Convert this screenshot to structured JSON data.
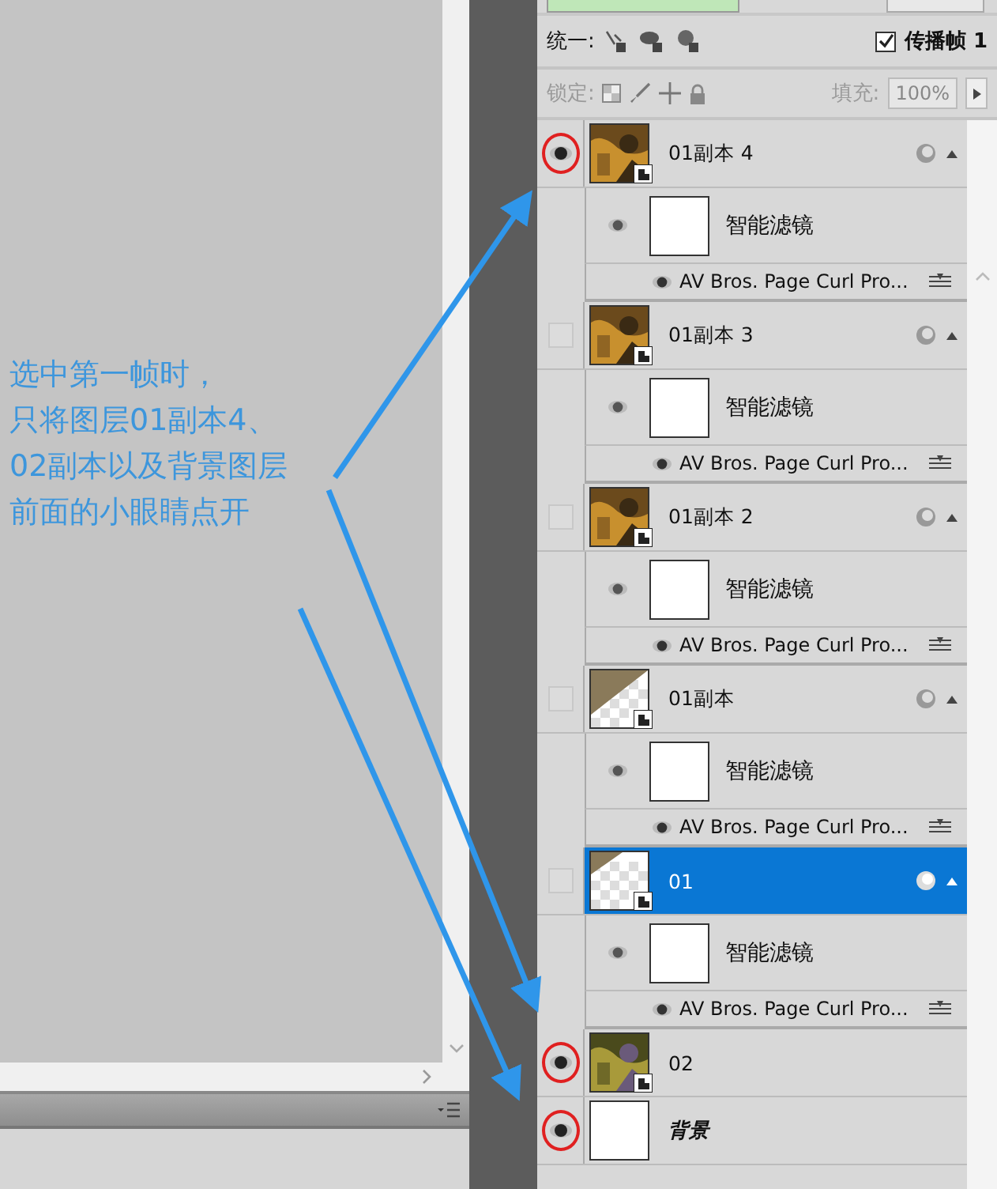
{
  "annotation": {
    "lines": [
      "选中第一帧时，",
      "只将图层01副本4、",
      "02副本以及背景图层",
      "前面的小眼睛点开"
    ]
  },
  "panel": {
    "unify_label": "统一:",
    "propagate": {
      "label": "传播帧 1",
      "checked": true
    },
    "lock_label": "锁定:",
    "fill_label": "填充:",
    "fill_value": "100%"
  },
  "layers": [
    {
      "name": "01副本 4",
      "visible": true,
      "highlighted": true,
      "selected": false,
      "filter": {
        "label": "智能滤镜",
        "effect": "AV Bros. Page Curl Pro..."
      }
    },
    {
      "name": "01副本 3",
      "visible": false,
      "highlighted": false,
      "selected": false,
      "filter": {
        "label": "智能滤镜",
        "effect": "AV Bros. Page Curl Pro..."
      }
    },
    {
      "name": "01副本 2",
      "visible": false,
      "highlighted": false,
      "selected": false,
      "filter": {
        "label": "智能滤镜",
        "effect": "AV Bros. Page Curl Pro..."
      }
    },
    {
      "name": "01副本",
      "kind": "curl",
      "visible": false,
      "highlighted": false,
      "selected": false,
      "filter": {
        "label": "智能滤镜",
        "effect": "AV Bros. Page Curl Pro..."
      }
    },
    {
      "name": "01",
      "kind": "transparent",
      "visible": false,
      "highlighted": false,
      "selected": true,
      "filter": {
        "label": "智能滤镜",
        "effect": "AV Bros. Page Curl Pro..."
      }
    },
    {
      "name": "02",
      "kind": "photo-green",
      "visible": true,
      "highlighted": true,
      "selected": false
    },
    {
      "name": "背景",
      "kind": "blank",
      "visible": true,
      "highlighted": true,
      "selected": false
    }
  ]
}
